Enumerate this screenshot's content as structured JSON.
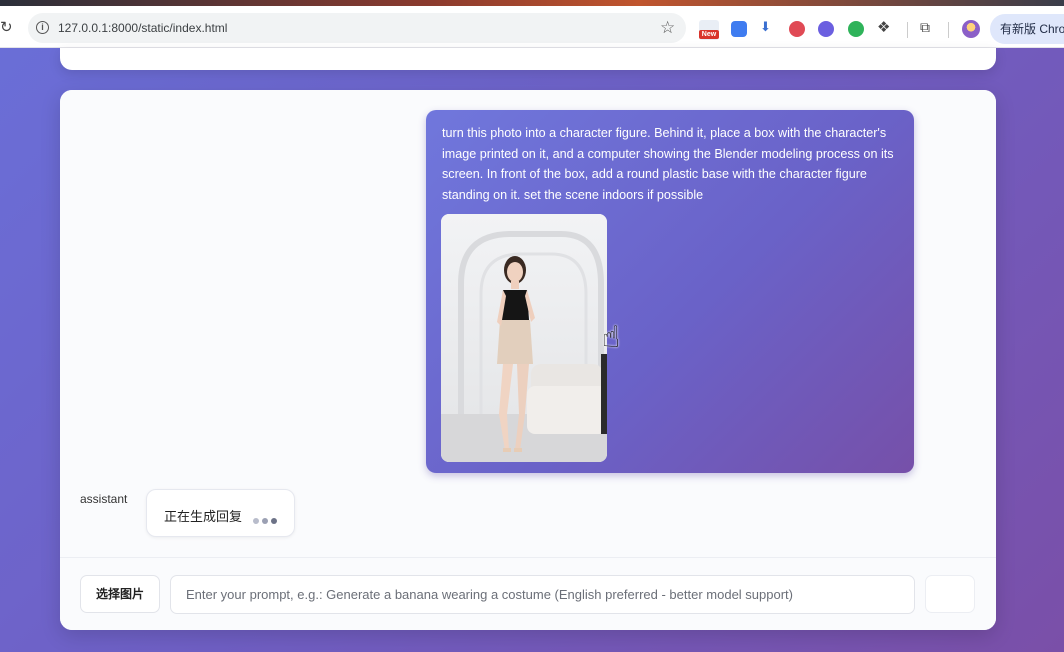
{
  "browser": {
    "url": "127.0.0.1:8000/static/index.html",
    "new_badge": "New",
    "update_button": "有新版 Chrom",
    "icons": [
      "reload-icon",
      "site-info-icon",
      "bookmark-star-icon",
      "new-extension-icon",
      "blue-extension-icon",
      "download-extension-icon",
      "red-extension-icon",
      "purple-extension-icon",
      "green-extension-icon",
      "puzzle-extensions-icon",
      "tab-search-icon",
      "profile-avatar"
    ]
  },
  "chat": {
    "user_message": "turn this photo into a character figure. Behind it, place a box with the character's image printed on it, and a computer showing the Blender modeling process on its screen. In front of the box, add a round plastic base with the character figure standing on it. set the scene indoors if possible",
    "assistant_label": "assistant",
    "typing_text": "正在生成回复"
  },
  "input": {
    "choose_image_label": "选择图片",
    "placeholder": "Enter your prompt, e.g.: Generate a banana wearing a costume (English preferred - better model support)",
    "value": ""
  },
  "colors": {
    "page_gradient_start": "#6a6fd8",
    "page_gradient_end": "#7a4fa8",
    "user_bubble": "#6a62c8"
  }
}
